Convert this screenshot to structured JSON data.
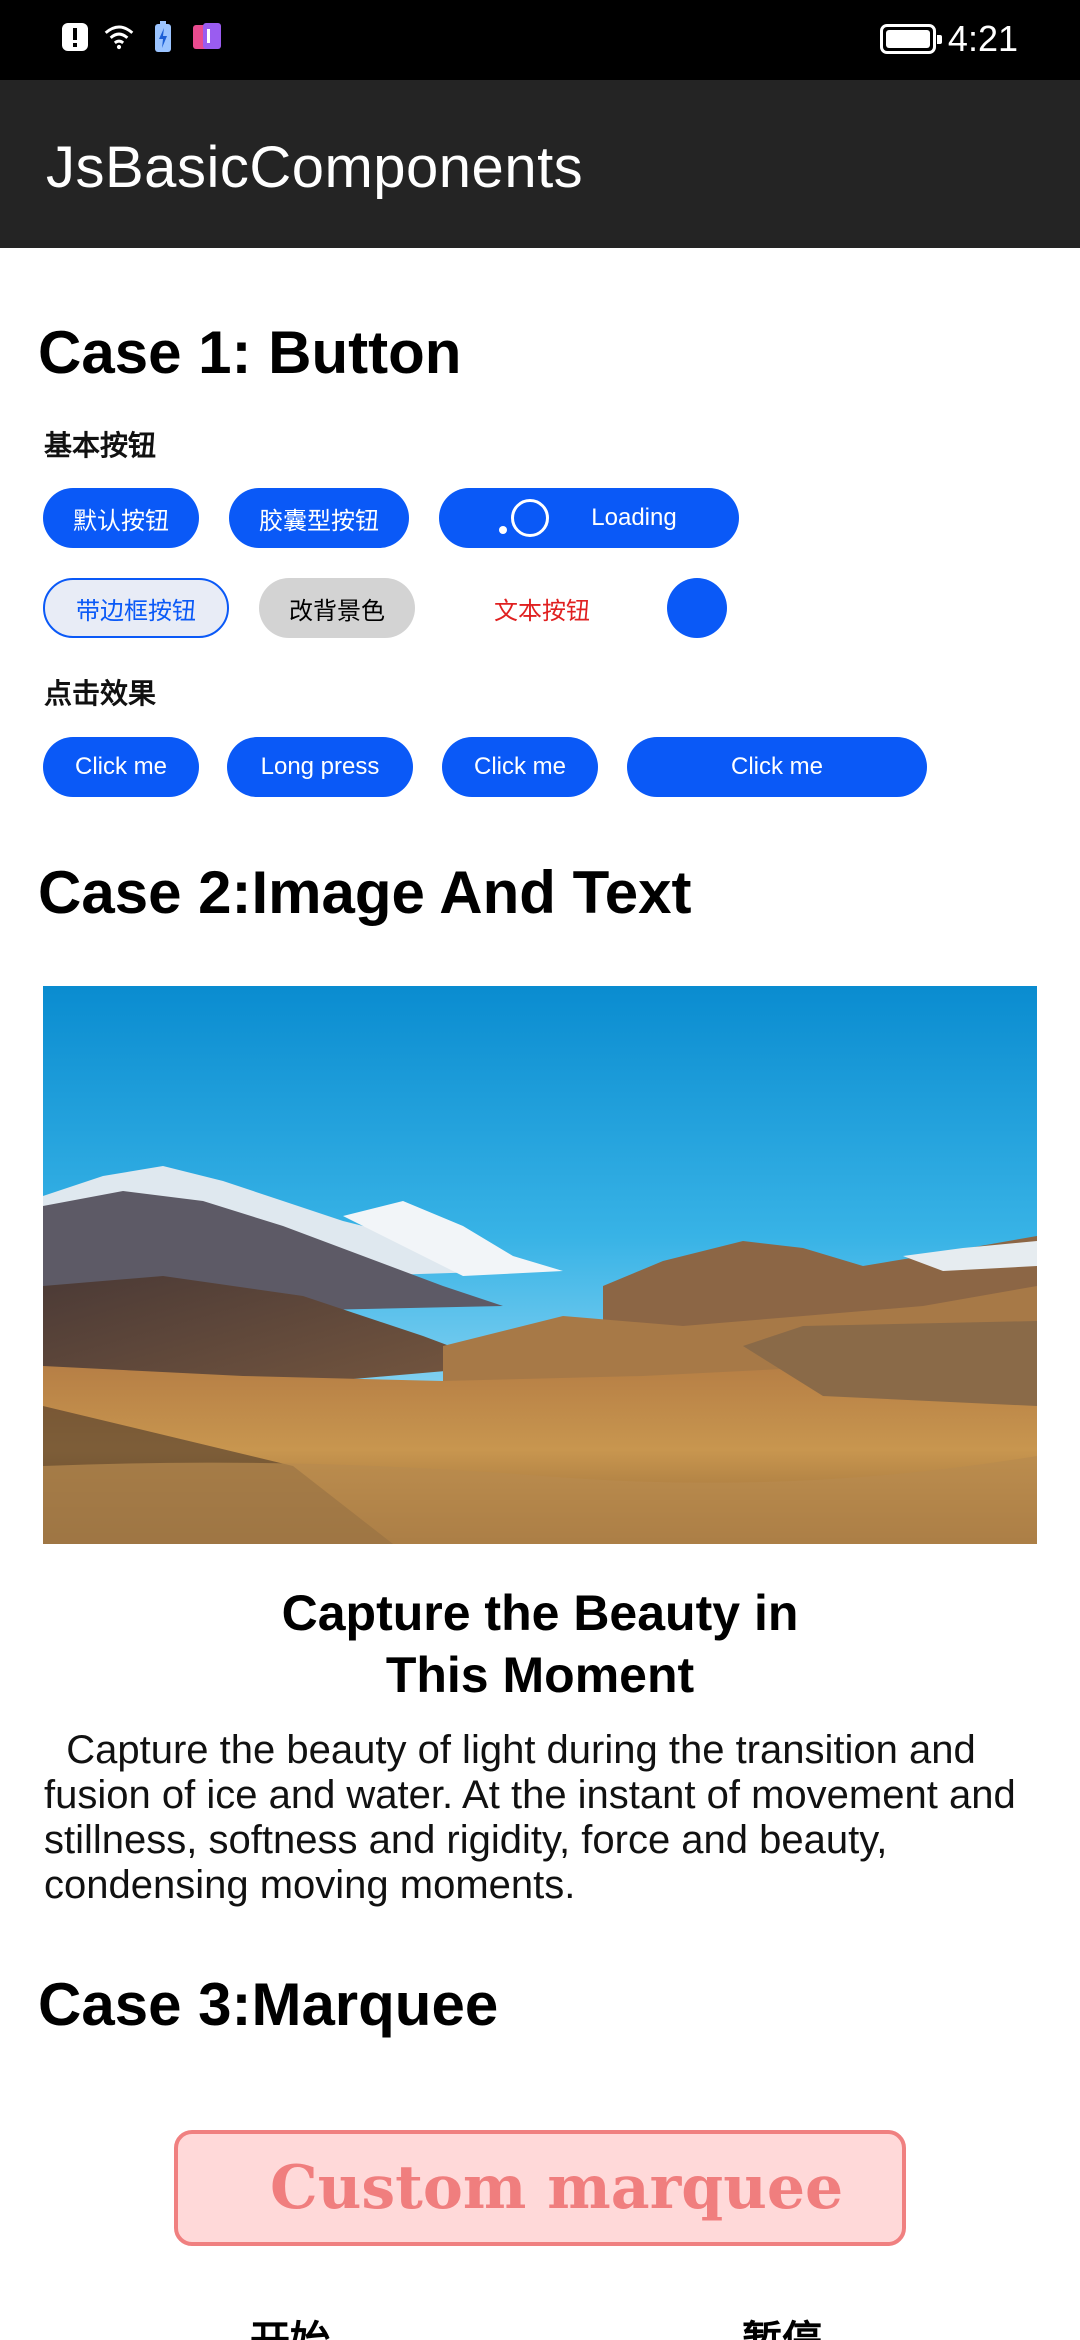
{
  "status_bar": {
    "time": "4:21",
    "icons": [
      "alert-icon",
      "wifi-icon",
      "battery-saver-icon",
      "app-notification-icon"
    ]
  },
  "app_bar": {
    "title": "JsBasicComponents"
  },
  "case1": {
    "title": "Case 1:   Button",
    "basic_label": "基本按钮",
    "basic_buttons": [
      "默认按钮",
      "胶囊型按钮",
      "Loading"
    ],
    "style_buttons": [
      "带边框按钮",
      "改背景色",
      "文本按钮"
    ],
    "click_label": "点击效果",
    "click_buttons": [
      "Click me",
      "Long press",
      "Click me",
      "Click me"
    ]
  },
  "case2": {
    "title": "Case 2:Image And Text",
    "caption": "Capture the Beauty in This Moment",
    "body": "Capture the beauty of light during the transition and fusion of ice and water. At the instant of movement and stillness, softness and rigidity, force and beauty, condensing moving moments."
  },
  "case3": {
    "title": "Case 3:Marquee",
    "marquee_text": "Custom marquee",
    "start_label": "开始",
    "pause_label": "暂停"
  },
  "colors": {
    "primary": "#0a59f7",
    "app_bar": "#242424",
    "text_button": "#e02020",
    "marquee_bg": "#ffd9d9",
    "marquee_border": "#f08080",
    "marquee_text": "#f07e7e"
  }
}
